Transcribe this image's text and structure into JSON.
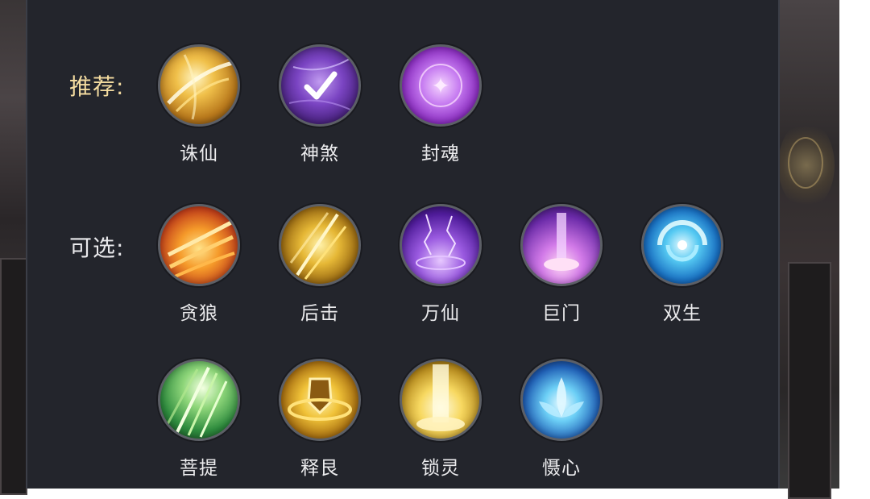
{
  "labels": {
    "recommended": "推荐:",
    "optional": "可选:"
  },
  "recommended": [
    {
      "name": "诛仙",
      "icon": "golden-slash-icon"
    },
    {
      "name": "神煞",
      "icon": "purple-check-icon"
    },
    {
      "name": "封魂",
      "icon": "seal-rune-icon"
    }
  ],
  "optional_row1": [
    {
      "name": "贪狼",
      "icon": "fire-claw-icon"
    },
    {
      "name": "后击",
      "icon": "golden-strike-icon"
    },
    {
      "name": "万仙",
      "icon": "purple-lightning-icon"
    },
    {
      "name": "巨门",
      "icon": "violet-pillar-icon"
    },
    {
      "name": "双生",
      "icon": "blue-swirl-icon"
    }
  ],
  "optional_row2": [
    {
      "name": "菩提",
      "icon": "green-beams-icon"
    },
    {
      "name": "释艮",
      "icon": "golden-shield-icon"
    },
    {
      "name": "锁灵",
      "icon": "light-beam-icon"
    },
    {
      "name": "慑心",
      "icon": "blue-lotus-icon"
    }
  ],
  "colors": {
    "panel": "#23252c",
    "recommended_label": "#f4dca0",
    "text": "#ececee"
  }
}
